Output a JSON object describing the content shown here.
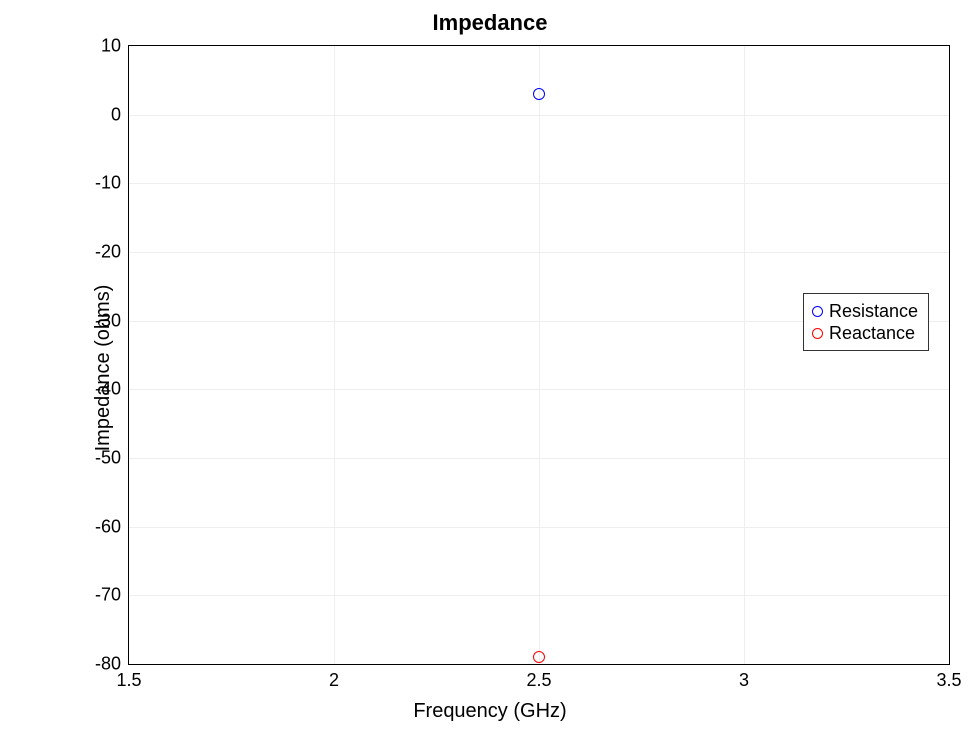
{
  "chart_data": {
    "type": "scatter",
    "title": "Impedance",
    "xlabel": "Frequency (GHz)",
    "ylabel": "Impedance (ohms)",
    "xlim": [
      1.5,
      3.5
    ],
    "ylim": [
      -80,
      10
    ],
    "xticks": [
      1.5,
      2,
      2.5,
      3,
      3.5
    ],
    "yticks": [
      -80,
      -70,
      -60,
      -50,
      -40,
      -30,
      -20,
      -10,
      0,
      10
    ],
    "series": [
      {
        "name": "Resistance",
        "color": "#0000ff",
        "x": [
          2.5
        ],
        "y": [
          3
        ]
      },
      {
        "name": "Reactance",
        "color": "#ff0000",
        "x": [
          2.5
        ],
        "y": [
          -79
        ]
      }
    ],
    "legend_position": "right"
  },
  "tick_labels": {
    "x": [
      "1.5",
      "2",
      "2.5",
      "3",
      "3.5"
    ],
    "y": [
      "-80",
      "-70",
      "-60",
      "-50",
      "-40",
      "-30",
      "-20",
      "-10",
      "0",
      "10"
    ]
  }
}
